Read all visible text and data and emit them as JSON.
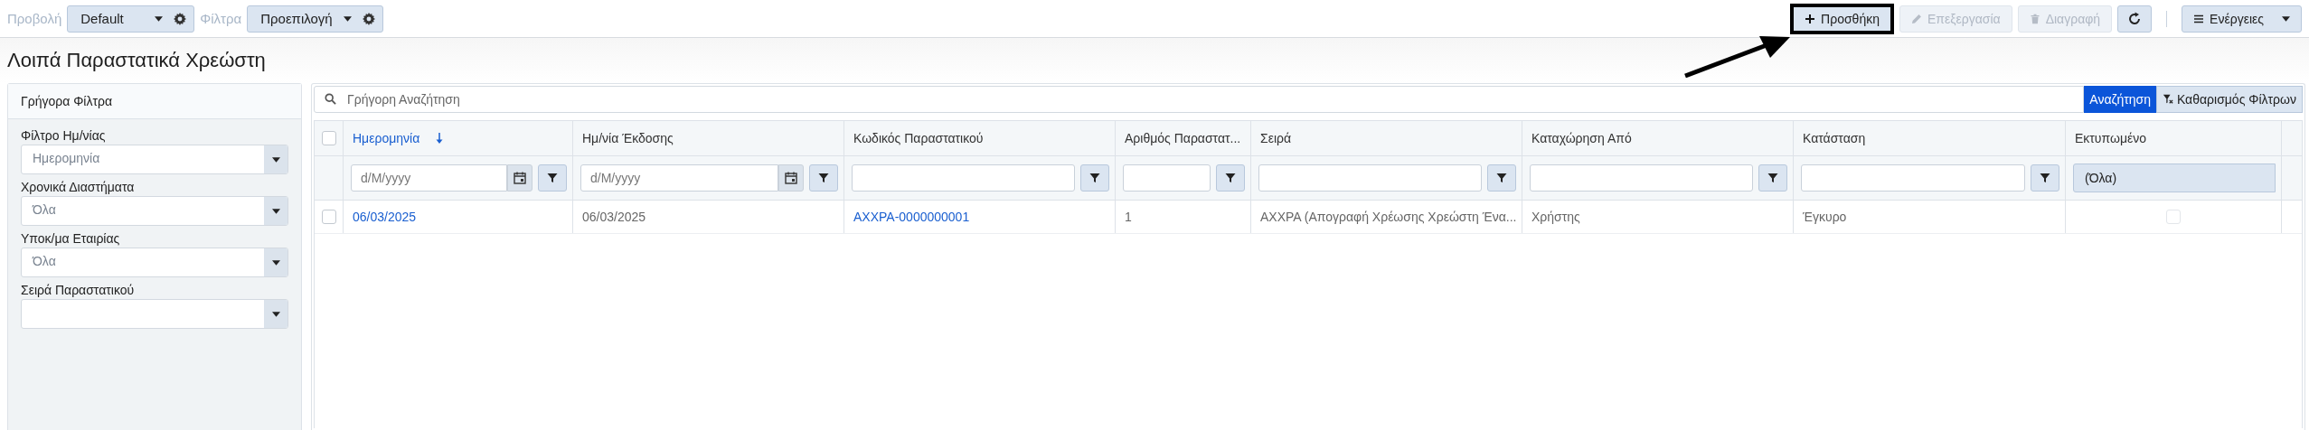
{
  "toolbar": {
    "view_label": "Προβολή",
    "view_value": "Default",
    "filters_label": "Φίλτρα",
    "filters_value": "Προεπιλογή",
    "actions": [
      {
        "kind": "add",
        "label": "Προσθήκη",
        "disabled": false,
        "highlighted": true
      },
      {
        "kind": "edit",
        "label": "Επεξεργασία",
        "disabled": true,
        "highlighted": false
      },
      {
        "kind": "delete",
        "label": "Διαγραφή",
        "disabled": true,
        "highlighted": false
      },
      {
        "kind": "refresh",
        "disabled": false,
        "highlighted": false
      },
      {
        "kind": "menu",
        "label": "Ενέργειες",
        "disabled": false,
        "highlighted": false
      }
    ]
  },
  "page_title": "Λοιπά Παραστατικά Χρεώστη",
  "quick_filters": {
    "title": "Γρήγορα Φίλτρα",
    "fields": [
      {
        "label": "Φίλτρο Ημ/νίας",
        "value": "Ημερομηνία"
      },
      {
        "label": "Χρονικά Διαστήματα",
        "value": "Όλα"
      },
      {
        "label": "Υποκ/μα Εταιρίας",
        "value": "Όλα"
      },
      {
        "label": "Σειρά Παραστατικού"
      }
    ]
  },
  "search": {
    "placeholder": "Γρήγορη Αναζήτηση",
    "search_button": "Αναζήτηση",
    "clear_button": "Καθαρισμός Φίλτρων"
  },
  "table": {
    "all_selected": false,
    "columns": [
      {
        "label": "Ημερομηνία",
        "sorted": true,
        "link": true,
        "kind": "date",
        "filter_placeholder": "d/M/yyyy"
      },
      {
        "label": "Ημ/νία Έκδοσης",
        "sorted": false,
        "link": false,
        "kind": "date",
        "filter_placeholder": "d/M/yyyy"
      },
      {
        "label": "Κωδικός Παραστατικού",
        "sorted": false,
        "link": true,
        "kind": "text"
      },
      {
        "label": "Αριθμός Παραστατ...",
        "sorted": false,
        "link": false,
        "kind": "text"
      },
      {
        "label": "Σειρά",
        "sorted": false,
        "link": false,
        "kind": "text"
      },
      {
        "label": "Καταχώρηση Από",
        "sorted": false,
        "link": false,
        "kind": "text"
      },
      {
        "label": "Κατάσταση",
        "sorted": false,
        "link": false,
        "kind": "text"
      },
      {
        "label": "Εκτυπωμένο",
        "sorted": false,
        "kind": "select",
        "filter_value": "(Όλα)"
      }
    ],
    "rows": [
      {
        "selected": false,
        "cells": [
          "06/03/2025",
          "06/03/2025",
          "ΑΧΧΡΑ-0000000001",
          "1",
          "ΑΧΧΡΑ (Απογραφή Χρέωσης Χρεώστη Ένα...",
          "Χρήστης",
          "Έγκυρο"
        ],
        "printed": false
      }
    ]
  }
}
